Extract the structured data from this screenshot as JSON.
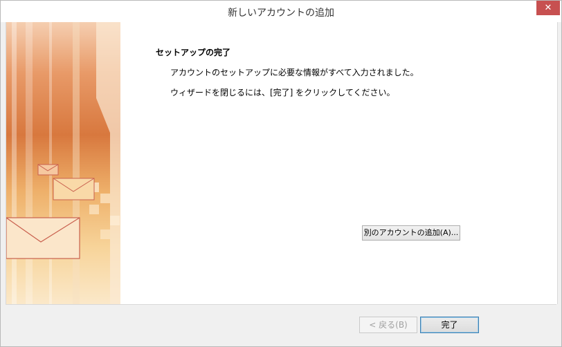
{
  "window": {
    "title": "新しいアカウントの追加",
    "close_symbol": "✕"
  },
  "main": {
    "heading": "セットアップの完了",
    "message_line1": "アカウントのセットアップに必要な情報がすべて入力されました。",
    "message_line2": "ウィザードを閉じるには、[完了] をクリックしてください。",
    "add_account_label": "別のアカウントの追加(A)..."
  },
  "footer": {
    "back_label": "< 戻る(B)",
    "finish_label": "完了"
  },
  "colors": {
    "close_button": "#c75050",
    "default_button_border": "#3c7fb1",
    "banner_orange": "#d8783e"
  },
  "icons": {
    "close": "close-icon",
    "banner": "envelope-banner-image"
  }
}
